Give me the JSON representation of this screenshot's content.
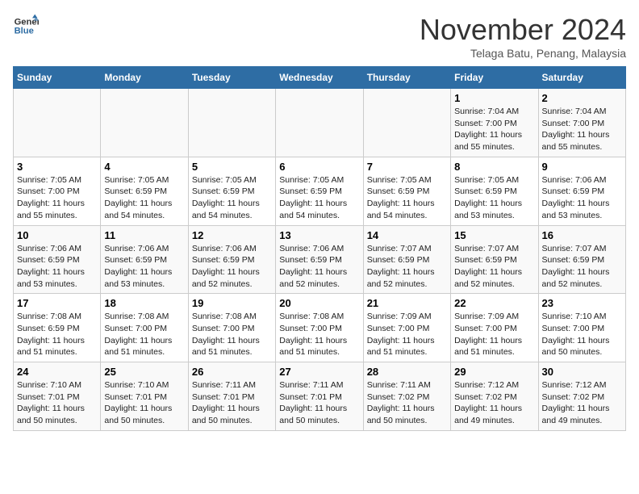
{
  "header": {
    "logo_general": "General",
    "logo_blue": "Blue",
    "month_title": "November 2024",
    "location": "Telaga Batu, Penang, Malaysia"
  },
  "days_of_week": [
    "Sunday",
    "Monday",
    "Tuesday",
    "Wednesday",
    "Thursday",
    "Friday",
    "Saturday"
  ],
  "weeks": [
    [
      {
        "num": "",
        "info": ""
      },
      {
        "num": "",
        "info": ""
      },
      {
        "num": "",
        "info": ""
      },
      {
        "num": "",
        "info": ""
      },
      {
        "num": "",
        "info": ""
      },
      {
        "num": "1",
        "info": "Sunrise: 7:04 AM\nSunset: 7:00 PM\nDaylight: 11 hours and 55 minutes."
      },
      {
        "num": "2",
        "info": "Sunrise: 7:04 AM\nSunset: 7:00 PM\nDaylight: 11 hours and 55 minutes."
      }
    ],
    [
      {
        "num": "3",
        "info": "Sunrise: 7:05 AM\nSunset: 7:00 PM\nDaylight: 11 hours and 55 minutes."
      },
      {
        "num": "4",
        "info": "Sunrise: 7:05 AM\nSunset: 6:59 PM\nDaylight: 11 hours and 54 minutes."
      },
      {
        "num": "5",
        "info": "Sunrise: 7:05 AM\nSunset: 6:59 PM\nDaylight: 11 hours and 54 minutes."
      },
      {
        "num": "6",
        "info": "Sunrise: 7:05 AM\nSunset: 6:59 PM\nDaylight: 11 hours and 54 minutes."
      },
      {
        "num": "7",
        "info": "Sunrise: 7:05 AM\nSunset: 6:59 PM\nDaylight: 11 hours and 54 minutes."
      },
      {
        "num": "8",
        "info": "Sunrise: 7:05 AM\nSunset: 6:59 PM\nDaylight: 11 hours and 53 minutes."
      },
      {
        "num": "9",
        "info": "Sunrise: 7:06 AM\nSunset: 6:59 PM\nDaylight: 11 hours and 53 minutes."
      }
    ],
    [
      {
        "num": "10",
        "info": "Sunrise: 7:06 AM\nSunset: 6:59 PM\nDaylight: 11 hours and 53 minutes."
      },
      {
        "num": "11",
        "info": "Sunrise: 7:06 AM\nSunset: 6:59 PM\nDaylight: 11 hours and 53 minutes."
      },
      {
        "num": "12",
        "info": "Sunrise: 7:06 AM\nSunset: 6:59 PM\nDaylight: 11 hours and 52 minutes."
      },
      {
        "num": "13",
        "info": "Sunrise: 7:06 AM\nSunset: 6:59 PM\nDaylight: 11 hours and 52 minutes."
      },
      {
        "num": "14",
        "info": "Sunrise: 7:07 AM\nSunset: 6:59 PM\nDaylight: 11 hours and 52 minutes."
      },
      {
        "num": "15",
        "info": "Sunrise: 7:07 AM\nSunset: 6:59 PM\nDaylight: 11 hours and 52 minutes."
      },
      {
        "num": "16",
        "info": "Sunrise: 7:07 AM\nSunset: 6:59 PM\nDaylight: 11 hours and 52 minutes."
      }
    ],
    [
      {
        "num": "17",
        "info": "Sunrise: 7:08 AM\nSunset: 6:59 PM\nDaylight: 11 hours and 51 minutes."
      },
      {
        "num": "18",
        "info": "Sunrise: 7:08 AM\nSunset: 7:00 PM\nDaylight: 11 hours and 51 minutes."
      },
      {
        "num": "19",
        "info": "Sunrise: 7:08 AM\nSunset: 7:00 PM\nDaylight: 11 hours and 51 minutes."
      },
      {
        "num": "20",
        "info": "Sunrise: 7:08 AM\nSunset: 7:00 PM\nDaylight: 11 hours and 51 minutes."
      },
      {
        "num": "21",
        "info": "Sunrise: 7:09 AM\nSunset: 7:00 PM\nDaylight: 11 hours and 51 minutes."
      },
      {
        "num": "22",
        "info": "Sunrise: 7:09 AM\nSunset: 7:00 PM\nDaylight: 11 hours and 51 minutes."
      },
      {
        "num": "23",
        "info": "Sunrise: 7:10 AM\nSunset: 7:00 PM\nDaylight: 11 hours and 50 minutes."
      }
    ],
    [
      {
        "num": "24",
        "info": "Sunrise: 7:10 AM\nSunset: 7:01 PM\nDaylight: 11 hours and 50 minutes."
      },
      {
        "num": "25",
        "info": "Sunrise: 7:10 AM\nSunset: 7:01 PM\nDaylight: 11 hours and 50 minutes."
      },
      {
        "num": "26",
        "info": "Sunrise: 7:11 AM\nSunset: 7:01 PM\nDaylight: 11 hours and 50 minutes."
      },
      {
        "num": "27",
        "info": "Sunrise: 7:11 AM\nSunset: 7:01 PM\nDaylight: 11 hours and 50 minutes."
      },
      {
        "num": "28",
        "info": "Sunrise: 7:11 AM\nSunset: 7:02 PM\nDaylight: 11 hours and 50 minutes."
      },
      {
        "num": "29",
        "info": "Sunrise: 7:12 AM\nSunset: 7:02 PM\nDaylight: 11 hours and 49 minutes."
      },
      {
        "num": "30",
        "info": "Sunrise: 7:12 AM\nSunset: 7:02 PM\nDaylight: 11 hours and 49 minutes."
      }
    ]
  ]
}
